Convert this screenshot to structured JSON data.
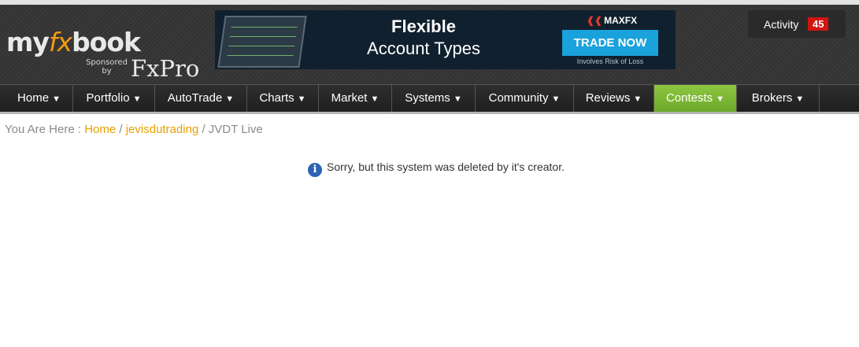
{
  "header": {
    "logo": {
      "prefix": "my",
      "fx": "fx",
      "suffix": "book",
      "sponsored": "Sponsored by",
      "sponsor": "FxPro"
    },
    "ad": {
      "headline": "Flexible",
      "subheadline": "Account Types",
      "brand": "MAXFX",
      "cta": "TRADE NOW",
      "risk": "Involves Risk of Loss"
    },
    "activity": {
      "label": "Activity",
      "count": "45"
    }
  },
  "nav": {
    "items": [
      {
        "label": "Home",
        "arrow": "▼"
      },
      {
        "label": "Portfolio",
        "arrow": "▼"
      },
      {
        "label": "AutoTrade",
        "arrow": "▼"
      },
      {
        "label": "Charts",
        "arrow": "▼"
      },
      {
        "label": "Market",
        "arrow": "▼"
      },
      {
        "label": "Systems",
        "arrow": "▼"
      },
      {
        "label": "Community",
        "arrow": "▼"
      },
      {
        "label": "Reviews",
        "arrow": "▼"
      },
      {
        "label": "Contests",
        "arrow": "▼",
        "active": true
      },
      {
        "label": "Brokers",
        "arrow": "▼"
      }
    ]
  },
  "breadcrumb": {
    "prefix": "You Are Here :",
    "home": "Home",
    "separator": "/",
    "user": "jevisdutrading",
    "current": "JVDT Live"
  },
  "message": {
    "icon": "info-icon",
    "text": "Sorry, but this system was deleted by it's creator."
  },
  "colors": {
    "accent": "#e8a000",
    "active_nav": "#8dc63f",
    "badge": "#d3140f",
    "cta": "#1aa2dc"
  }
}
